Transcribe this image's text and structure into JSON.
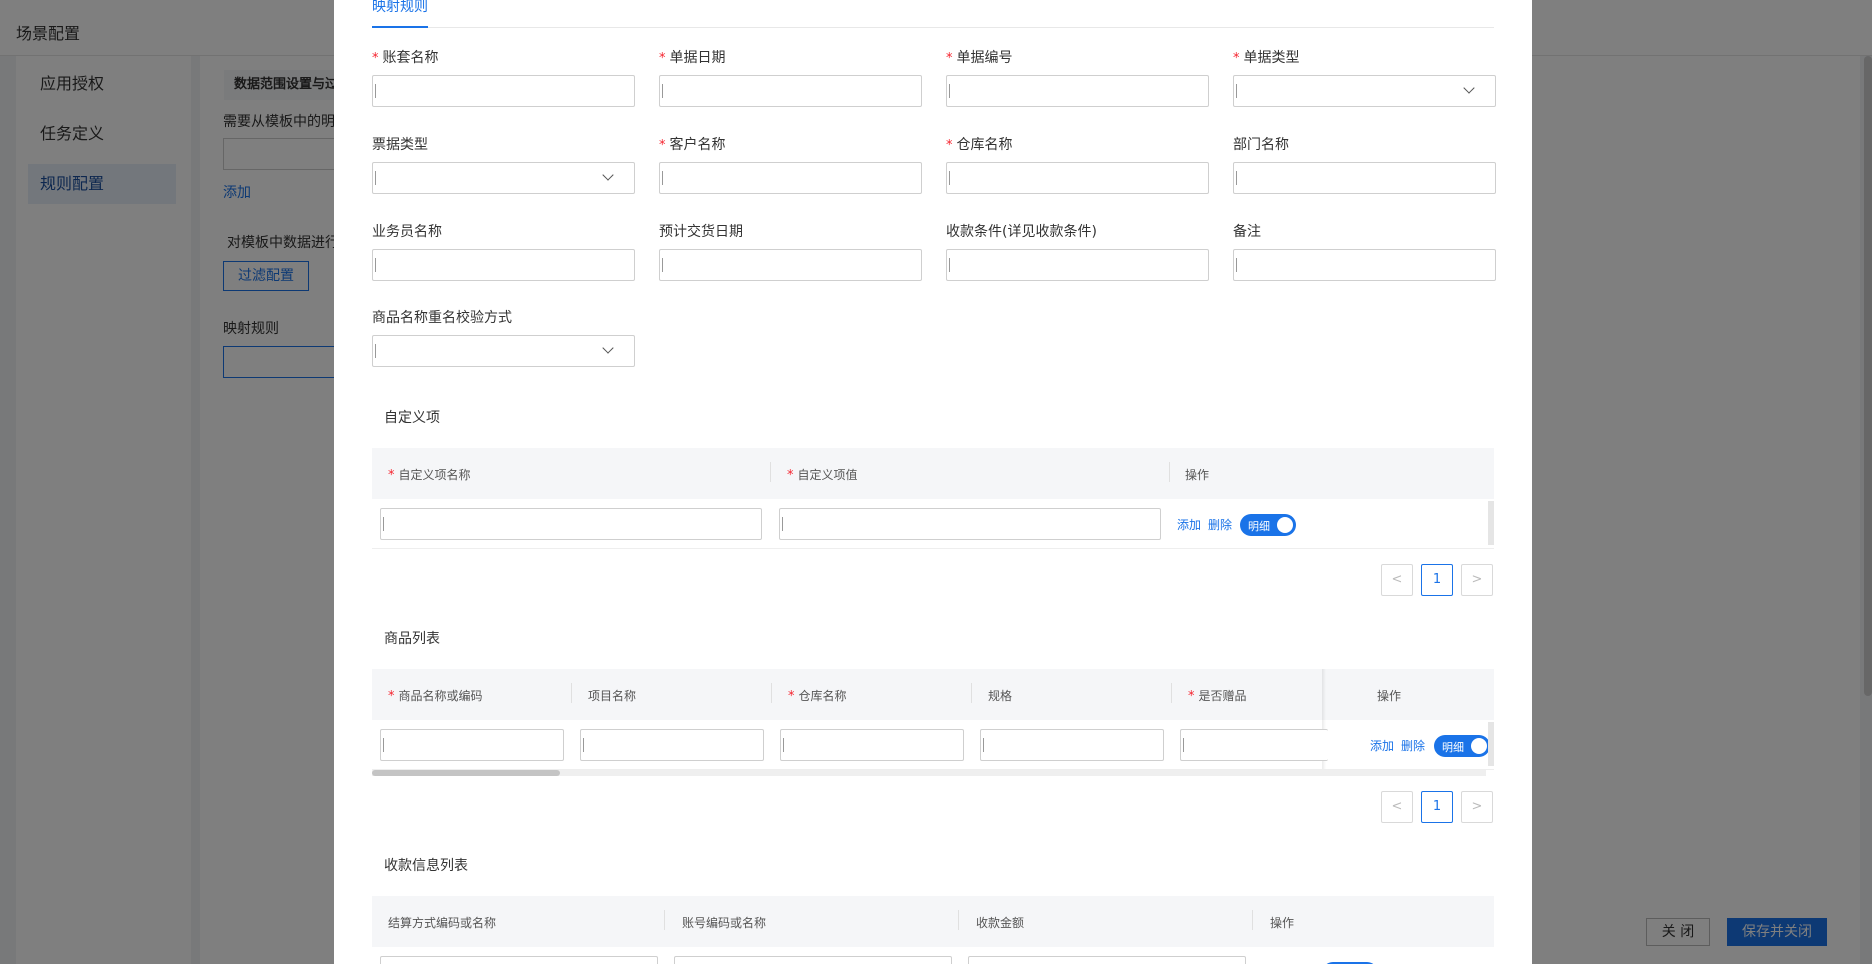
{
  "background": {
    "title": "场景配置",
    "nav": [
      {
        "label": "应用授权",
        "active": false
      },
      {
        "label": "任务定义",
        "active": false
      },
      {
        "label": "规则配置",
        "active": true
      }
    ],
    "section_title": "数据范围设置与过",
    "need_text": "需要从模板中的明",
    "add_link": "添加",
    "filter_text": "对模板中数据进行",
    "filter_button": "过滤配置",
    "mapping_label": "映射规则",
    "close_button": "关 闭",
    "save_close_button": "保存并关闭"
  },
  "modal": {
    "tab": "映射规则",
    "fields": [
      {
        "label": "账套名称",
        "required": true,
        "type": "input"
      },
      {
        "label": "单据日期",
        "required": true,
        "type": "input"
      },
      {
        "label": "单据编号",
        "required": true,
        "type": "input"
      },
      {
        "label": "单据类型",
        "required": true,
        "type": "select"
      },
      {
        "label": "票据类型",
        "required": false,
        "type": "select"
      },
      {
        "label": "客户名称",
        "required": true,
        "type": "input"
      },
      {
        "label": "仓库名称",
        "required": true,
        "type": "input"
      },
      {
        "label": "部门名称",
        "required": false,
        "type": "input"
      },
      {
        "label": "业务员名称",
        "required": false,
        "type": "input"
      },
      {
        "label": "预计交货日期",
        "required": false,
        "type": "input"
      },
      {
        "label": "收款条件(详见收款条件)",
        "required": false,
        "type": "input"
      },
      {
        "label": "备注",
        "required": false,
        "type": "input"
      },
      {
        "label": "商品名称重名校验方式",
        "required": false,
        "type": "select"
      }
    ],
    "custom": {
      "title": "自定义项",
      "columns": [
        {
          "label": "自定义项名称",
          "required": true
        },
        {
          "label": "自定义项值",
          "required": true
        },
        {
          "label": "操作",
          "required": false
        }
      ],
      "row": {
        "add": "添加",
        "delete": "删除",
        "toggle": "明细",
        "toggle_on": true
      },
      "page": "1"
    },
    "products": {
      "title": "商品列表",
      "columns": [
        {
          "label": "商品名称或编码",
          "required": true
        },
        {
          "label": "项目名称",
          "required": false
        },
        {
          "label": "仓库名称",
          "required": true
        },
        {
          "label": "规格",
          "required": false
        },
        {
          "label": "是否赠品",
          "required": true
        },
        {
          "label": "操作",
          "required": false
        }
      ],
      "row": {
        "add": "添加",
        "delete": "删除",
        "toggle": "明细",
        "toggle_on": true
      },
      "page": "1"
    },
    "payments": {
      "title": "收款信息列表",
      "columns": [
        {
          "label": "结算方式编码或名称",
          "required": false
        },
        {
          "label": "账号编码或名称",
          "required": false
        },
        {
          "label": "收款金额",
          "required": false
        },
        {
          "label": "操作",
          "required": false
        }
      ]
    },
    "pager": {
      "prev": "<",
      "next": ">"
    },
    "colors": {
      "primary": "#1a73e8",
      "required": "#f5222d"
    }
  }
}
